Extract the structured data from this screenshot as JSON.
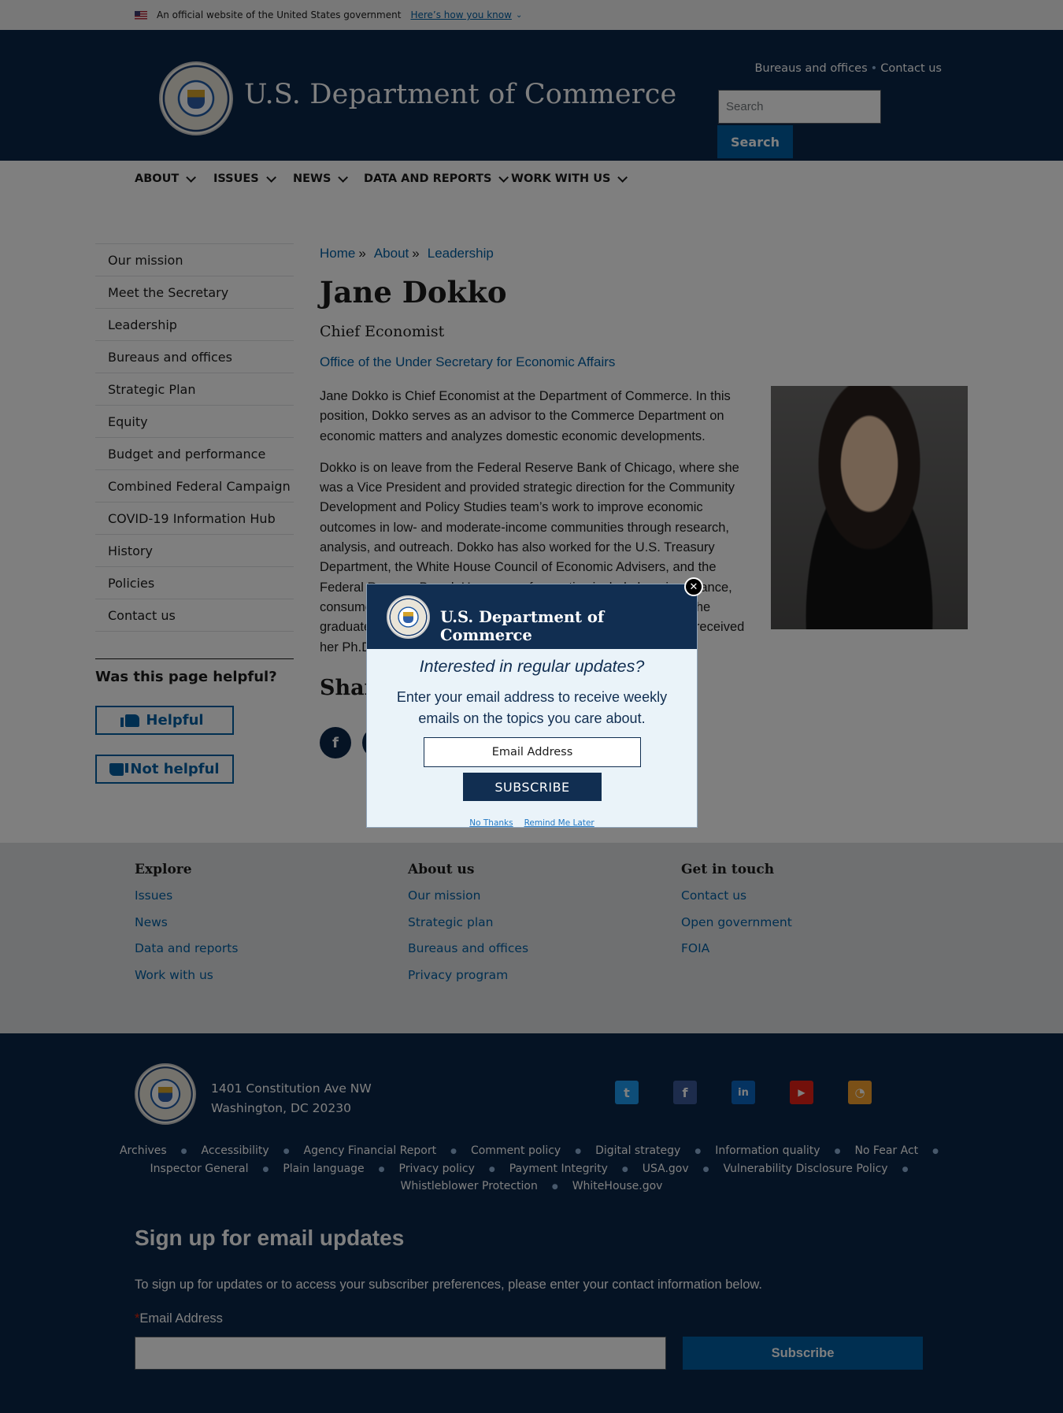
{
  "gov_banner": {
    "text": "An official website of the United States government",
    "link": "Here’s how you know"
  },
  "header": {
    "site_title": "U.S. Department of Commerce",
    "util_links": [
      "Bureaus and offices",
      "Contact us"
    ],
    "search_placeholder": "Search",
    "search_button": "Search"
  },
  "nav": [
    "ABOUT",
    "ISSUES",
    "NEWS",
    "DATA AND REPORTS",
    "WORK WITH US"
  ],
  "sidenav": [
    "Our mission",
    "Meet the Secretary",
    "Leadership",
    "Bureaus and offices",
    "Strategic Plan",
    "Equity",
    "Budget and performance",
    "Combined Federal Campaign",
    "COVID-19 Information Hub",
    "History",
    "Policies",
    "Contact us"
  ],
  "helpful": {
    "heading": "Was this page helpful?",
    "yes": "Helpful",
    "no": "Not helpful"
  },
  "breadcrumb": [
    "Home",
    "About",
    "Leadership"
  ],
  "profile": {
    "name": "Jane Dokko",
    "title": "Chief Economist",
    "office": "Office of the Under Secretary for Economic Affairs",
    "bio_p1": "Jane Dokko is Chief Economist at the Department of Commerce. In this position, Dokko serves as an advisor to the Commerce Department on economic matters and analyzes domestic economic developments.",
    "bio_p2": "Dokko is on leave from the Federal Reserve Bank of Chicago, where she was a Vice President and provided strategic direction for the Community Development and Policy Studies team’s work to improve economic outcomes in low- and moderate-income communities through research, analysis, and outreach. Dokko has also worked for the U.S. Treasury Department, the White House Council of Economic Advisers, and the Federal Reserve Board. Her areas of expertise include housing finance, consumer finance, and community and economic development. She graduated from Harvard College with a degree in economics and received her Ph.D. in economics.",
    "share_heading": "Share"
  },
  "footer_explore": {
    "columns": [
      {
        "heading": "Explore",
        "links": [
          "Issues",
          "News",
          "Data and reports",
          "Work with us"
        ]
      },
      {
        "heading": "About us",
        "links": [
          "Our mission",
          "Strategic plan",
          "Bureaus and offices",
          "Privacy program"
        ]
      },
      {
        "heading": "Get in touch",
        "links": [
          "Contact us",
          "Open government",
          "FOIA"
        ]
      }
    ]
  },
  "footer_bottom": {
    "address_line1": "1401 Constitution Ave NW",
    "address_line2": "Washington, DC 20230",
    "social": [
      "twitter-icon",
      "facebook-icon",
      "linkedin-icon",
      "youtube-icon",
      "rss-icon"
    ],
    "links_row1": [
      "Archives",
      "Accessibility",
      "Agency Financial Report",
      "Comment policy",
      "Digital strategy",
      "Information quality",
      "No Fear Act"
    ],
    "links_row2": [
      "Inspector General",
      "Plain language",
      "Privacy policy",
      "Payment Integrity",
      "USA.gov",
      "Vulnerability Disclosure Policy"
    ],
    "links_row3": [
      "Whistleblower Protection",
      "WhiteHouse.gov"
    ],
    "signup_heading": "Sign up for email updates",
    "signup_text": "To sign up for updates or to access your subscriber preferences, please enter your contact information below.",
    "email_label": "Email Address",
    "required_mark": "*",
    "subscribe_button": "Subscribe"
  },
  "modal": {
    "title": "U.S. Department of Commerce",
    "question": "Interested in regular updates?",
    "text": "Enter your email address to receive weekly emails on the topics you care about.",
    "email_placeholder": "Email Address",
    "subscribe": "SUBSCRIBE",
    "no_thanks": "No Thanks",
    "remind_later": "Remind Me Later",
    "close_symbol": "✕"
  },
  "colors": {
    "navy": "#0b2649",
    "link_blue": "#005ea2",
    "modal_navy": "#112e51"
  }
}
